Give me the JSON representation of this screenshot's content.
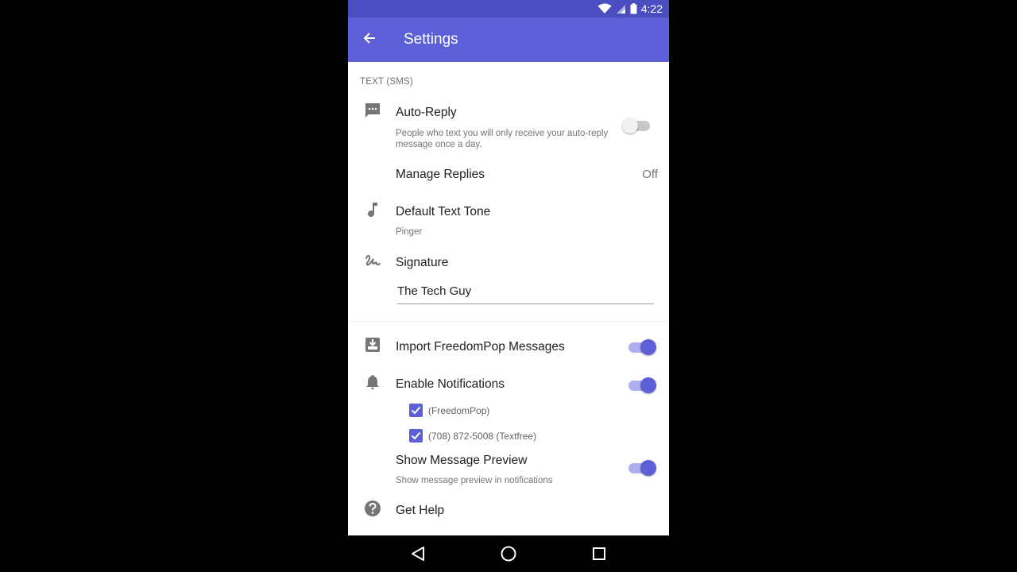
{
  "status_bar": {
    "time": "4:22"
  },
  "app_bar": {
    "title": "Settings"
  },
  "section": {
    "header": "TEXT (SMS)"
  },
  "auto_reply": {
    "label": "Auto-Reply",
    "description_line1": "People who text you will only receive your auto-reply",
    "description_line2": "message once a day.",
    "enabled": false
  },
  "manage_replies": {
    "label": "Manage Replies",
    "value": "Off"
  },
  "text_tone": {
    "label": "Default Text Tone",
    "value": "Pinger"
  },
  "signature": {
    "label": "Signature",
    "value": "The Tech Guy"
  },
  "import_messages": {
    "label": "Import FreedomPop Messages",
    "enabled": true
  },
  "notifications": {
    "label": "Enable Notifications",
    "enabled": true,
    "accounts": [
      {
        "label": "(FreedomPop)",
        "checked": true
      },
      {
        "label": "(708) 872-5008 (Textfree)",
        "checked": true
      }
    ]
  },
  "message_preview": {
    "label": "Show Message Preview",
    "description": "Show message preview in notifications",
    "enabled": true
  },
  "help": {
    "label": "Get Help"
  },
  "colors": {
    "accent": "#5c5fd6",
    "status_bar": "#4a4ec0",
    "accent_track": "#aeb0ee"
  },
  "icons": [
    "wifi-icon",
    "signal-icon",
    "battery-icon",
    "back-arrow-icon",
    "message-icon",
    "music-note-icon",
    "signature-icon",
    "import-icon",
    "bell-icon",
    "checkbox-icon",
    "help-icon",
    "nav-back-icon",
    "nav-home-icon",
    "nav-recents-icon"
  ]
}
